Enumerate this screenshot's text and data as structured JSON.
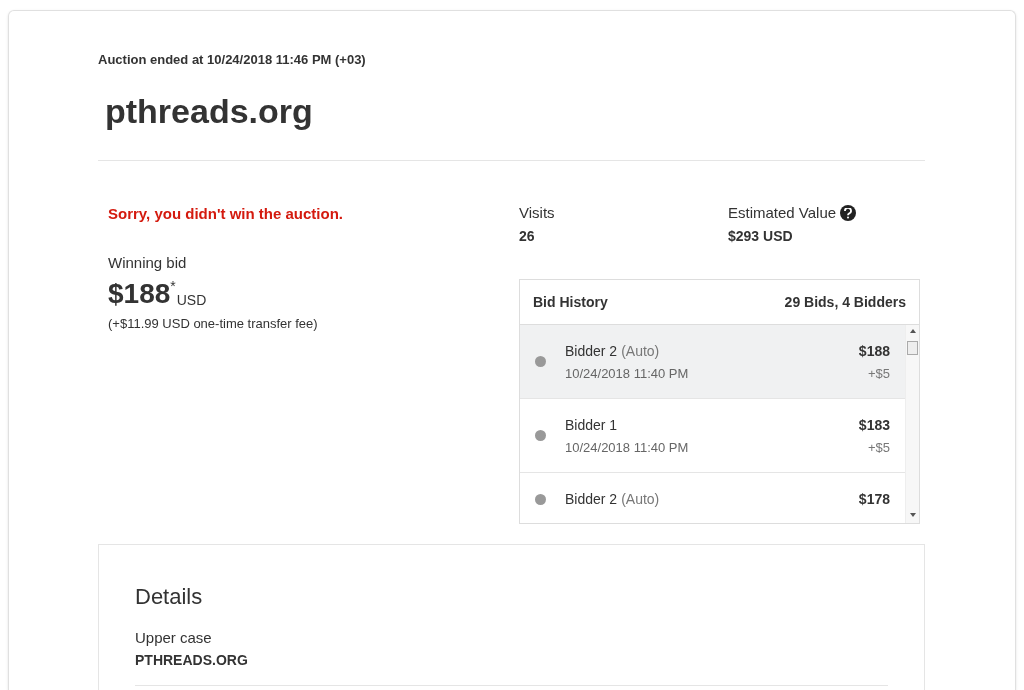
{
  "auction_end": "Auction ended at 10/24/2018 11:46 PM (+03)",
  "domain": "pthreads.org",
  "result_message": "Sorry, you didn't win the auction.",
  "winning_bid": {
    "label": "Winning bid",
    "amount": "$188",
    "footnote": "*",
    "currency": "USD",
    "fee_note": "(+$11.99 USD one-time transfer fee)"
  },
  "stats": [
    {
      "label": "Visits",
      "value": "26",
      "help": false
    },
    {
      "label": "Estimated Value",
      "value": "$293 USD",
      "help": true
    }
  ],
  "bid_history": {
    "title": "Bid History",
    "summary": "29 Bids, 4 Bidders",
    "bids": [
      {
        "bidder": "Bidder 2",
        "tag": "(Auto)",
        "time": "10/24/2018 11:40 PM",
        "amount": "$188",
        "increment": "+$5",
        "selected": true
      },
      {
        "bidder": "Bidder 1",
        "time": "10/24/2018 11:40 PM",
        "amount": "$183",
        "increment": "+$5",
        "selected": false
      },
      {
        "bidder": "Bidder 2",
        "tag": "(Auto)",
        "amount": "$178",
        "selected": false
      }
    ]
  },
  "details": {
    "title": "Details",
    "items": [
      {
        "label": "Upper case",
        "value": "PTHREADS.ORG"
      }
    ]
  }
}
